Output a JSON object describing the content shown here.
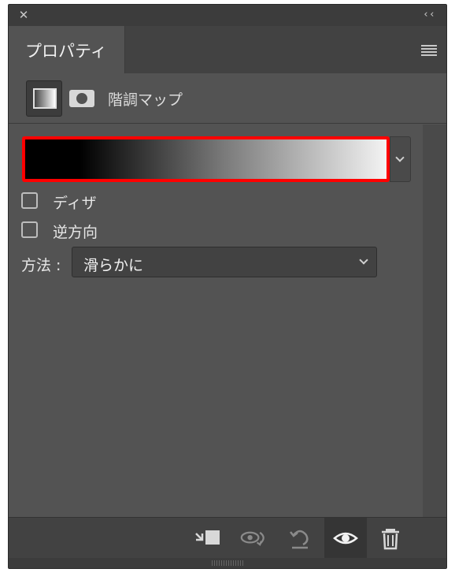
{
  "panel": {
    "tab_label": "プロパティ",
    "collapse_glyph": "‹‹",
    "close_glyph": "✕"
  },
  "header": {
    "title": "階調マップ"
  },
  "gradient": {
    "selected": true,
    "stops": [
      "#000000",
      "#7a7a7a",
      "#f3f3f3"
    ]
  },
  "options": {
    "dither_label": "ディザ",
    "dither_checked": false,
    "reverse_label": "逆方向",
    "reverse_checked": false,
    "method_label": "方法 :",
    "method_value": "滑らかに"
  },
  "footer": {
    "icons": [
      "clip-to-layer-icon",
      "view-previous-state-icon",
      "reset-icon",
      "visibility-eye-icon",
      "trash-icon"
    ]
  },
  "colors": {
    "panel_bg": "#535353",
    "selection_outline": "#ff0000"
  }
}
